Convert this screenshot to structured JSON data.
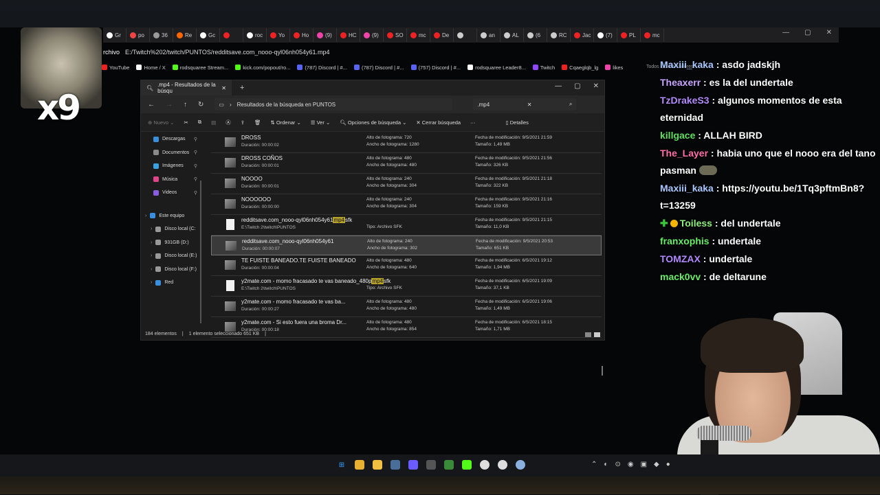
{
  "browser": {
    "tabs": [
      {
        "label": "Gr",
        "color": "#ffffff"
      },
      {
        "label": "po",
        "color": "#e44"
      },
      {
        "label": "36",
        "color": "#999"
      },
      {
        "label": "Re",
        "color": "#f60"
      },
      {
        "label": "Gc",
        "color": "#fff"
      },
      {
        "label": "",
        "color": "#e22"
      },
      {
        "label": "roc",
        "color": "#fff"
      },
      {
        "label": "Yo",
        "color": "#e22"
      },
      {
        "label": "Ho",
        "color": "#e22"
      },
      {
        "label": "(9)",
        "color": "#e4a"
      },
      {
        "label": "HC",
        "color": "#e22"
      },
      {
        "label": "(9)",
        "color": "#e4a"
      },
      {
        "label": "SO",
        "color": "#e22"
      },
      {
        "label": "mc",
        "color": "#e22"
      },
      {
        "label": "De",
        "color": "#e22"
      },
      {
        "label": "",
        "color": "#ccc"
      },
      {
        "label": "an",
        "color": "#ccc"
      },
      {
        "label": "AL",
        "color": "#ccc"
      },
      {
        "label": "(6",
        "color": "#ccc"
      },
      {
        "label": "RC",
        "color": "#ccc"
      },
      {
        "label": "Jac",
        "color": "#e22"
      },
      {
        "label": "(7)",
        "color": "#fff"
      },
      {
        "label": "PL",
        "color": "#e22"
      },
      {
        "label": "mc",
        "color": "#e22"
      }
    ],
    "address_label": "rchivo",
    "address": "E:/Twitch%202/twitch/PUNTOS/redditsave.com_nooo-qyl06nh054y61.mp4",
    "bookmarks": [
      {
        "label": "YouTube",
        "color": "#e22"
      },
      {
        "label": "Home / X",
        "color": "#fff"
      },
      {
        "label": "rodsquaree Stream...",
        "color": "#53fc18"
      },
      {
        "label": "kick.com/popout/ro...",
        "color": "#53fc18"
      },
      {
        "label": "(787) Discord | #...",
        "color": "#5865f2"
      },
      {
        "label": "(787) Discord | #...",
        "color": "#5865f2"
      },
      {
        "label": "(757) Discord | #...",
        "color": "#5865f2"
      },
      {
        "label": "rodsquaree Leader8...",
        "color": "#fff"
      },
      {
        "label": "Twitch",
        "color": "#9146ff"
      },
      {
        "label": "Cqaeglqb_lg",
        "color": "#e22"
      },
      {
        "label": "likes",
        "color": "#e4a"
      }
    ],
    "all_bookmarks": "Todos los marcadores"
  },
  "overlay": {
    "counter": "x9"
  },
  "explorer": {
    "tab_title": ".mp4 - Resultados de la búsqu",
    "path": "Resultados de la búsqueda en PUNTOS",
    "search_value": ".mp4",
    "toolbar": {
      "new": "Nuevo",
      "sort": "Ordenar",
      "view": "Ver",
      "search_options": "Opciones de búsqueda",
      "close_search": "Cerrar búsqueda",
      "details": "Detalles"
    },
    "sidebar": [
      {
        "label": "Descargas",
        "color": "#3a8fdc",
        "pin": true
      },
      {
        "label": "Documentos",
        "color": "#8a8a8a",
        "pin": true
      },
      {
        "label": "Imágenes",
        "color": "#3aa0e0",
        "pin": true
      },
      {
        "label": "Música",
        "color": "#e0458a",
        "pin": true
      },
      {
        "label": "Videos",
        "color": "#8a5ce0",
        "pin": true
      },
      {
        "label": "",
        "color": "",
        "pin": false
      },
      {
        "label": "Este equipo",
        "color": "#3a8fdc",
        "pin": false
      },
      {
        "label": "Disco local (C:",
        "color": "#999",
        "pin": false
      },
      {
        "label": "931GB (D:)",
        "color": "#999",
        "pin": false
      },
      {
        "label": "Disco local (E:)",
        "color": "#999",
        "pin": false
      },
      {
        "label": "Disco local (F:)",
        "color": "#999",
        "pin": false
      },
      {
        "label": "Red",
        "color": "#3a8fdc",
        "pin": false
      }
    ],
    "files": [
      {
        "name": "DROSS",
        "hl": "",
        "name_after": "",
        "sub": "Duración: 00:00:02",
        "c2a": "Alto de fotograma: 720",
        "c2b": "Ancho de fotograma: 1280",
        "c3a": "Fecha de modificación: 9/5/2021 21:59",
        "c3b": "Tamaño: 1,49 MB",
        "type": "video",
        "selected": false
      },
      {
        "name": "DROSS COÑOS",
        "hl": "",
        "name_after": "",
        "sub": "Duración: 00:00:01",
        "c2a": "Alto de fotograma: 480",
        "c2b": "Ancho de fotograma: 480",
        "c3a": "Fecha de modificación: 9/5/2021 21:56",
        "c3b": "Tamaño: 326 KB",
        "type": "video",
        "selected": false
      },
      {
        "name": "NOOOO",
        "hl": "",
        "name_after": "",
        "sub": "Duración: 00:00:01",
        "c2a": "Alto de fotograma: 240",
        "c2b": "Ancho de fotograma: 304",
        "c3a": "Fecha de modificación: 9/5/2021 21:18",
        "c3b": "Tamaño: 322 KB",
        "type": "video",
        "selected": false
      },
      {
        "name": "NOOOOOO",
        "hl": "",
        "name_after": "",
        "sub": "Duración: 00:00:00",
        "c2a": "Alto de fotograma: 240",
        "c2b": "Ancho de fotograma: 304",
        "c3a": "Fecha de modificación: 9/5/2021 21:16",
        "c3b": "Tamaño: 159 KB",
        "type": "video",
        "selected": false
      },
      {
        "name": "redditsave.com_nooo-qyl06nh054y61",
        "hl": "mp4",
        "name_after": "sfk",
        "sub": "E:\\Twitch 2\\twitch\\PUNTOS",
        "c2a": "",
        "c2b": "Tipo: Archivo SFK",
        "c3a": "Fecha de modificación: 9/5/2021 21:15",
        "c3b": "Tamaño: 11,0 KB",
        "type": "file",
        "selected": false
      },
      {
        "name": "redditsave.com_nooo-qyl06nh054y61",
        "hl": "",
        "name_after": "",
        "sub": "Duración: 00:00:07",
        "c2a": "Alto de fotograma: 240",
        "c2b": "Ancho de fotograma: 302",
        "c3a": "Fecha de modificación: 9/5/2021 20:53",
        "c3b": "Tamaño: 651 KB",
        "type": "video",
        "selected": true
      },
      {
        "name": "TE FUISTE BANEADO.TE FUISTE BANEADO",
        "hl": "",
        "name_after": "",
        "sub": "Duración: 00:00:04",
        "c2a": "Alto de fotograma: 480",
        "c2b": "Ancho de fotograma: 640",
        "c3a": "Fecha de modificación: 6/5/2021 19:12",
        "c3b": "Tamaño: 1,94 MB",
        "type": "video",
        "selected": false
      },
      {
        "name": "y2mate.com - momo fracasado te vas baneado_480p",
        "hl": "mp4",
        "name_after": "sfk",
        "sub": "E:\\Twitch 2\\twitch\\PUNTOS",
        "c2a": "",
        "c2b": "Tipo: Archivo SFK",
        "c3a": "Fecha de modificación: 6/5/2021 19:09",
        "c3b": "Tamaño: 37,1 KB",
        "type": "file",
        "selected": false
      },
      {
        "name": "y2mate.com - momo fracasado te vas ba...",
        "hl": "",
        "name_after": "",
        "sub": "Duración: 00:00:27",
        "c2a": "Alto de fotograma: 480",
        "c2b": "Ancho de fotograma: 480",
        "c3a": "Fecha de modificación: 6/5/2021 19:06",
        "c3b": "Tamaño: 1,49 MB",
        "type": "video",
        "selected": false
      },
      {
        "name": "y2mate.com - Si esto fuera una broma Dr...",
        "hl": "",
        "name_after": "",
        "sub": "Duración: 00:00:18",
        "c2a": "Alto de fotograma: 480",
        "c2b": "Ancho de fotograma: 854",
        "c3a": "Fecha de modificación: 6/5/2021 18:15",
        "c3b": "Tamaño: 1,71 MB",
        "type": "video",
        "selected": false
      }
    ],
    "status": {
      "count": "184 elementos",
      "selected": "1 elemento seleccionado  651 KB"
    }
  },
  "chat": [
    {
      "user": "Maxiii_kaka",
      "color": "#a8c8ff",
      "text": "asdo jadskjh",
      "badge": false,
      "emote": false
    },
    {
      "user": "Theaxerr",
      "color": "#c9a5ff",
      "text": "es la del undertale",
      "badge": false,
      "emote": false
    },
    {
      "user": "TzDrakeS3",
      "color": "#b38bff",
      "text": "algunos momentos de esta eternidad",
      "badge": false,
      "emote": false
    },
    {
      "user": "killgace",
      "color": "#5fe05f",
      "text": "ALLAH BIRD",
      "badge": false,
      "emote": false
    },
    {
      "user": "The_Layer",
      "color": "#ff6fa8",
      "text": "habia uno que el nooo era del tano pasman",
      "badge": false,
      "emote": true
    },
    {
      "user": "Maxiii_kaka",
      "color": "#a8c8ff",
      "text": "https://youtu.be/1Tq3pftmBn8?t=13259",
      "badge": false,
      "emote": false
    },
    {
      "user": "Toiless",
      "color": "#8cf07a",
      "text": "del undertale",
      "badge": true,
      "emote": false
    },
    {
      "user": "franxophis",
      "color": "#66ee66",
      "text": "undertale",
      "badge": false,
      "emote": false
    },
    {
      "user": "TOMZAX",
      "color": "#b388ff",
      "text": "undertale",
      "badge": false,
      "emote": false
    },
    {
      "user": "mack0vv",
      "color": "#66ee66",
      "text": "de deltarune",
      "badge": false,
      "emote": false
    }
  ],
  "taskbar": {
    "apps": [
      {
        "name": "windows-start",
        "color": "#3aa0ff"
      },
      {
        "name": "chrome",
        "color": "#e8b030"
      },
      {
        "name": "file-explorer",
        "color": "#f0c040"
      },
      {
        "name": "steam",
        "color": "#4a6e9a"
      },
      {
        "name": "media-player",
        "color": "#6a5cff"
      },
      {
        "name": "obs",
        "color": "#555"
      },
      {
        "name": "minecraft",
        "color": "#3a8a3a"
      },
      {
        "name": "kick",
        "color": "#53fc18"
      },
      {
        "name": "app-circle-1",
        "color": "#ddd"
      },
      {
        "name": "app-circle-2",
        "color": "#ddd"
      },
      {
        "name": "app-circle-3",
        "color": "#8ab0e0"
      }
    ]
  }
}
